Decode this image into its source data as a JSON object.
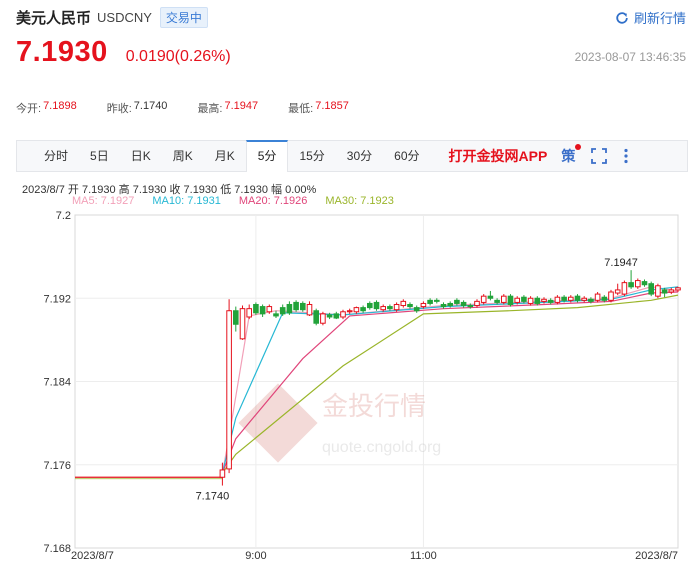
{
  "header": {
    "title": "美元人民币",
    "code": "USDCNY",
    "status": "交易中",
    "refresh_label": "刷新行情"
  },
  "quote": {
    "price": "7.1930",
    "change": "0.0190(0.26%)",
    "datetime": "2023-08-07 13:46:35"
  },
  "stats": [
    {
      "label": "今开:",
      "value": "7.1898"
    },
    {
      "label": "昨收:",
      "value": "7.1740"
    },
    {
      "label": "最高:",
      "value": "7.1947"
    },
    {
      "label": "最低:",
      "value": "7.1857"
    }
  ],
  "toolbar": {
    "tabs": [
      "分时",
      "5日",
      "日K",
      "周K",
      "月K",
      "5分",
      "15分",
      "30分",
      "60分"
    ],
    "active_tab": "5分",
    "app_link": "打开金投网APP",
    "strategy_label": "策"
  },
  "bar_info": {
    "date": "2023/8/7",
    "open_label": "开",
    "open": "7.1930",
    "high_label": "高",
    "high": "7.1930",
    "close_label": "收",
    "close": "7.1930",
    "low_label": "低",
    "low": "7.1930",
    "amp_label": "幅",
    "amp": "0.00%"
  },
  "ma_legend": [
    {
      "label": "MA5: 7.1927",
      "color": "#f2a0b8"
    },
    {
      "label": "MA10: 7.1931",
      "color": "#27b8d4"
    },
    {
      "label": "MA20: 7.1926",
      "color": "#e0457a"
    },
    {
      "label": "MA30: 7.1923",
      "color": "#9ab52a"
    }
  ],
  "watermark": {
    "cn": "金投行情",
    "url": "quote.cngold.org"
  },
  "colors": {
    "up": "#e5121d",
    "down": "#22a33a",
    "accent": "#3b82d6"
  },
  "chart_data": {
    "type": "candlestick",
    "title": "",
    "ylim": [
      7.168,
      7.2
    ],
    "yticks": [
      "7.2",
      "7.192",
      "7.184",
      "7.176",
      "7.168"
    ],
    "ytick_values": [
      7.2,
      7.192,
      7.184,
      7.176,
      7.168
    ],
    "xticks": [
      "2023/8/7",
      "9:00",
      "11:00",
      "2023/8/7"
    ],
    "xtick_pos": [
      0,
      27,
      52,
      90
    ],
    "annotations": [
      {
        "text": "7.1947",
        "i": 83,
        "value": 7.1947
      },
      {
        "text": "7.1740",
        "i": 22,
        "value": 7.174
      }
    ],
    "flat": {
      "value": 7.1748,
      "from": 0,
      "to": 22
    },
    "candles": [
      {
        "i": 22,
        "o": 7.1748,
        "c": 7.1755,
        "h": 7.1762,
        "l": 7.174
      },
      {
        "i": 23,
        "o": 7.1756,
        "c": 7.1908,
        "h": 7.1919,
        "l": 7.1752
      },
      {
        "i": 24,
        "o": 7.1908,
        "c": 7.1895,
        "h": 7.1912,
        "l": 7.1888
      },
      {
        "i": 25,
        "o": 7.1881,
        "c": 7.191,
        "h": 7.1913,
        "l": 7.188
      },
      {
        "i": 26,
        "o": 7.1902,
        "c": 7.191,
        "h": 7.1914,
        "l": 7.19
      },
      {
        "i": 27,
        "o": 7.1914,
        "c": 7.1906,
        "h": 7.1916,
        "l": 7.1904
      },
      {
        "i": 28,
        "o": 7.1912,
        "c": 7.1905,
        "h": 7.1914,
        "l": 7.1902
      },
      {
        "i": 29,
        "o": 7.1907,
        "c": 7.1912,
        "h": 7.1914,
        "l": 7.1905
      },
      {
        "i": 30,
        "o": 7.1905,
        "c": 7.1903,
        "h": 7.1908,
        "l": 7.1901
      },
      {
        "i": 31,
        "o": 7.1911,
        "c": 7.1905,
        "h": 7.1914,
        "l": 7.1903
      },
      {
        "i": 32,
        "o": 7.1914,
        "c": 7.1906,
        "h": 7.1917,
        "l": 7.1904
      },
      {
        "i": 33,
        "o": 7.1916,
        "c": 7.1909,
        "h": 7.1918,
        "l": 7.1907
      },
      {
        "i": 34,
        "o": 7.1915,
        "c": 7.1909,
        "h": 7.1917,
        "l": 7.1907
      },
      {
        "i": 35,
        "o": 7.1904,
        "c": 7.1914,
        "h": 7.1917,
        "l": 7.1903
      },
      {
        "i": 36,
        "o": 7.1908,
        "c": 7.1896,
        "h": 7.191,
        "l": 7.1894
      },
      {
        "i": 37,
        "o": 7.1896,
        "c": 7.1905,
        "h": 7.1907,
        "l": 7.1894
      },
      {
        "i": 38,
        "o": 7.1904,
        "c": 7.1902,
        "h": 7.1906,
        "l": 7.19
      },
      {
        "i": 39,
        "o": 7.1905,
        "c": 7.1901,
        "h": 7.1907,
        "l": 7.19
      },
      {
        "i": 40,
        "o": 7.1902,
        "c": 7.1907,
        "h": 7.1909,
        "l": 7.19
      },
      {
        "i": 41,
        "o": 7.1907,
        "c": 7.1908,
        "h": 7.191,
        "l": 7.1905
      },
      {
        "i": 42,
        "o": 7.1907,
        "c": 7.1911,
        "h": 7.1912,
        "l": 7.1905
      },
      {
        "i": 43,
        "o": 7.1911,
        "c": 7.1908,
        "h": 7.1913,
        "l": 7.1906
      },
      {
        "i": 44,
        "o": 7.1915,
        "c": 7.1911,
        "h": 7.1917,
        "l": 7.1909
      },
      {
        "i": 45,
        "o": 7.1916,
        "c": 7.191,
        "h": 7.1918,
        "l": 7.1908
      },
      {
        "i": 46,
        "o": 7.1909,
        "c": 7.1912,
        "h": 7.1914,
        "l": 7.1907
      },
      {
        "i": 47,
        "o": 7.1912,
        "c": 7.191,
        "h": 7.1914,
        "l": 7.1908
      },
      {
        "i": 48,
        "o": 7.1909,
        "c": 7.1914,
        "h": 7.1916,
        "l": 7.1907
      },
      {
        "i": 49,
        "o": 7.1913,
        "c": 7.1917,
        "h": 7.1919,
        "l": 7.1911
      },
      {
        "i": 50,
        "o": 7.1914,
        "c": 7.1912,
        "h": 7.1916,
        "l": 7.191
      },
      {
        "i": 51,
        "o": 7.1911,
        "c": 7.1908,
        "h": 7.1913,
        "l": 7.1906
      },
      {
        "i": 52,
        "o": 7.1912,
        "c": 7.1915,
        "h": 7.1917,
        "l": 7.191
      },
      {
        "i": 53,
        "o": 7.1918,
        "c": 7.1915,
        "h": 7.192,
        "l": 7.1913
      },
      {
        "i": 54,
        "o": 7.1918,
        "c": 7.1917,
        "h": 7.192,
        "l": 7.1915
      },
      {
        "i": 55,
        "o": 7.1914,
        "c": 7.1912,
        "h": 7.1916,
        "l": 7.191
      },
      {
        "i": 56,
        "o": 7.1915,
        "c": 7.1913,
        "h": 7.1917,
        "l": 7.1911
      },
      {
        "i": 57,
        "o": 7.1918,
        "c": 7.1915,
        "h": 7.192,
        "l": 7.1913
      },
      {
        "i": 58,
        "o": 7.1916,
        "c": 7.1913,
        "h": 7.1918,
        "l": 7.1911
      },
      {
        "i": 59,
        "o": 7.1913,
        "c": 7.1912,
        "h": 7.1915,
        "l": 7.191
      },
      {
        "i": 60,
        "o": 7.1913,
        "c": 7.1917,
        "h": 7.1919,
        "l": 7.1911
      },
      {
        "i": 61,
        "o": 7.1916,
        "c": 7.1922,
        "h": 7.1924,
        "l": 7.1914
      },
      {
        "i": 62,
        "o": 7.1922,
        "c": 7.192,
        "h": 7.1927,
        "l": 7.1918
      },
      {
        "i": 63,
        "o": 7.1918,
        "c": 7.1916,
        "h": 7.192,
        "l": 7.1914
      },
      {
        "i": 64,
        "o": 7.1916,
        "c": 7.1922,
        "h": 7.1924,
        "l": 7.1914
      },
      {
        "i": 65,
        "o": 7.1922,
        "c": 7.1914,
        "h": 7.1924,
        "l": 7.1912
      },
      {
        "i": 66,
        "o": 7.1916,
        "c": 7.192,
        "h": 7.1922,
        "l": 7.1914
      },
      {
        "i": 67,
        "o": 7.1921,
        "c": 7.1917,
        "h": 7.1923,
        "l": 7.1915
      },
      {
        "i": 68,
        "o": 7.1915,
        "c": 7.192,
        "h": 7.1922,
        "l": 7.1913
      },
      {
        "i": 69,
        "o": 7.192,
        "c": 7.1915,
        "h": 7.1922,
        "l": 7.1913
      },
      {
        "i": 70,
        "o": 7.1917,
        "c": 7.1919,
        "h": 7.1921,
        "l": 7.1915
      },
      {
        "i": 71,
        "o": 7.1918,
        "c": 7.1916,
        "h": 7.192,
        "l": 7.1914
      },
      {
        "i": 72,
        "o": 7.1916,
        "c": 7.1921,
        "h": 7.1923,
        "l": 7.1914
      },
      {
        "i": 73,
        "o": 7.1921,
        "c": 7.1918,
        "h": 7.1923,
        "l": 7.1916
      },
      {
        "i": 74,
        "o": 7.1918,
        "c": 7.1921,
        "h": 7.1923,
        "l": 7.1916
      },
      {
        "i": 75,
        "o": 7.1922,
        "c": 7.1918,
        "h": 7.1924,
        "l": 7.1916
      },
      {
        "i": 76,
        "o": 7.1918,
        "c": 7.192,
        "h": 7.1922,
        "l": 7.1916
      },
      {
        "i": 77,
        "o": 7.1919,
        "c": 7.1917,
        "h": 7.1921,
        "l": 7.1915
      },
      {
        "i": 78,
        "o": 7.1918,
        "c": 7.1924,
        "h": 7.1926,
        "l": 7.1916
      },
      {
        "i": 79,
        "o": 7.1921,
        "c": 7.1918,
        "h": 7.1923,
        "l": 7.1916
      },
      {
        "i": 80,
        "o": 7.1918,
        "c": 7.1926,
        "h": 7.1928,
        "l": 7.1916
      },
      {
        "i": 81,
        "o": 7.1925,
        "c": 7.1928,
        "h": 7.1934,
        "l": 7.1923
      },
      {
        "i": 82,
        "o": 7.1924,
        "c": 7.1935,
        "h": 7.1937,
        "l": 7.1922
      },
      {
        "i": 83,
        "o": 7.1935,
        "c": 7.1931,
        "h": 7.1947,
        "l": 7.1929
      },
      {
        "i": 84,
        "o": 7.1931,
        "c": 7.1937,
        "h": 7.1939,
        "l": 7.1929
      },
      {
        "i": 85,
        "o": 7.1936,
        "c": 7.1933,
        "h": 7.1938,
        "l": 7.1931
      },
      {
        "i": 86,
        "o": 7.1934,
        "c": 7.1924,
        "h": 7.1936,
        "l": 7.1922
      },
      {
        "i": 87,
        "o": 7.1922,
        "c": 7.1932,
        "h": 7.1934,
        "l": 7.192
      },
      {
        "i": 88,
        "o": 7.1928,
        "c": 7.1925,
        "h": 7.193,
        "l": 7.1921
      },
      {
        "i": 89,
        "o": 7.1926,
        "c": 7.1928,
        "h": 7.193,
        "l": 7.1924
      },
      {
        "i": 90,
        "o": 7.1928,
        "c": 7.193,
        "h": 7.1931,
        "l": 7.1926
      }
    ],
    "series": [
      {
        "name": "MA5",
        "color": "#f2a0b8",
        "points": [
          [
            22,
            7.1752
          ],
          [
            23,
            7.1787
          ],
          [
            26,
            7.1903
          ],
          [
            30,
            7.1908
          ],
          [
            40,
            7.1904
          ],
          [
            55,
            7.1913
          ],
          [
            70,
            7.1917
          ],
          [
            80,
            7.192
          ],
          [
            86,
            7.1931
          ],
          [
            90,
            7.1927
          ]
        ]
      },
      {
        "name": "MA10",
        "color": "#27b8d4",
        "points": [
          [
            22,
            7.1752
          ],
          [
            24,
            7.1805
          ],
          [
            31,
            7.1906
          ],
          [
            40,
            7.1904
          ],
          [
            55,
            7.1912
          ],
          [
            70,
            7.1916
          ],
          [
            80,
            7.1919
          ],
          [
            86,
            7.1928
          ],
          [
            90,
            7.1931
          ]
        ]
      },
      {
        "name": "MA20",
        "color": "#e0457a",
        "points": [
          [
            22,
            7.1752
          ],
          [
            24,
            7.1785
          ],
          [
            34,
            7.1862
          ],
          [
            41,
            7.1903
          ],
          [
            55,
            7.191
          ],
          [
            70,
            7.1914
          ],
          [
            80,
            7.1917
          ],
          [
            86,
            7.1925
          ],
          [
            90,
            7.1926
          ]
        ]
      },
      {
        "name": "MA30",
        "color": "#9ab52a",
        "points": [
          [
            22,
            7.1752
          ],
          [
            24,
            7.177
          ],
          [
            40,
            7.1855
          ],
          [
            52,
            7.1905
          ],
          [
            65,
            7.1908
          ],
          [
            75,
            7.1911
          ],
          [
            86,
            7.1918
          ],
          [
            90,
            7.1923
          ]
        ]
      }
    ]
  }
}
